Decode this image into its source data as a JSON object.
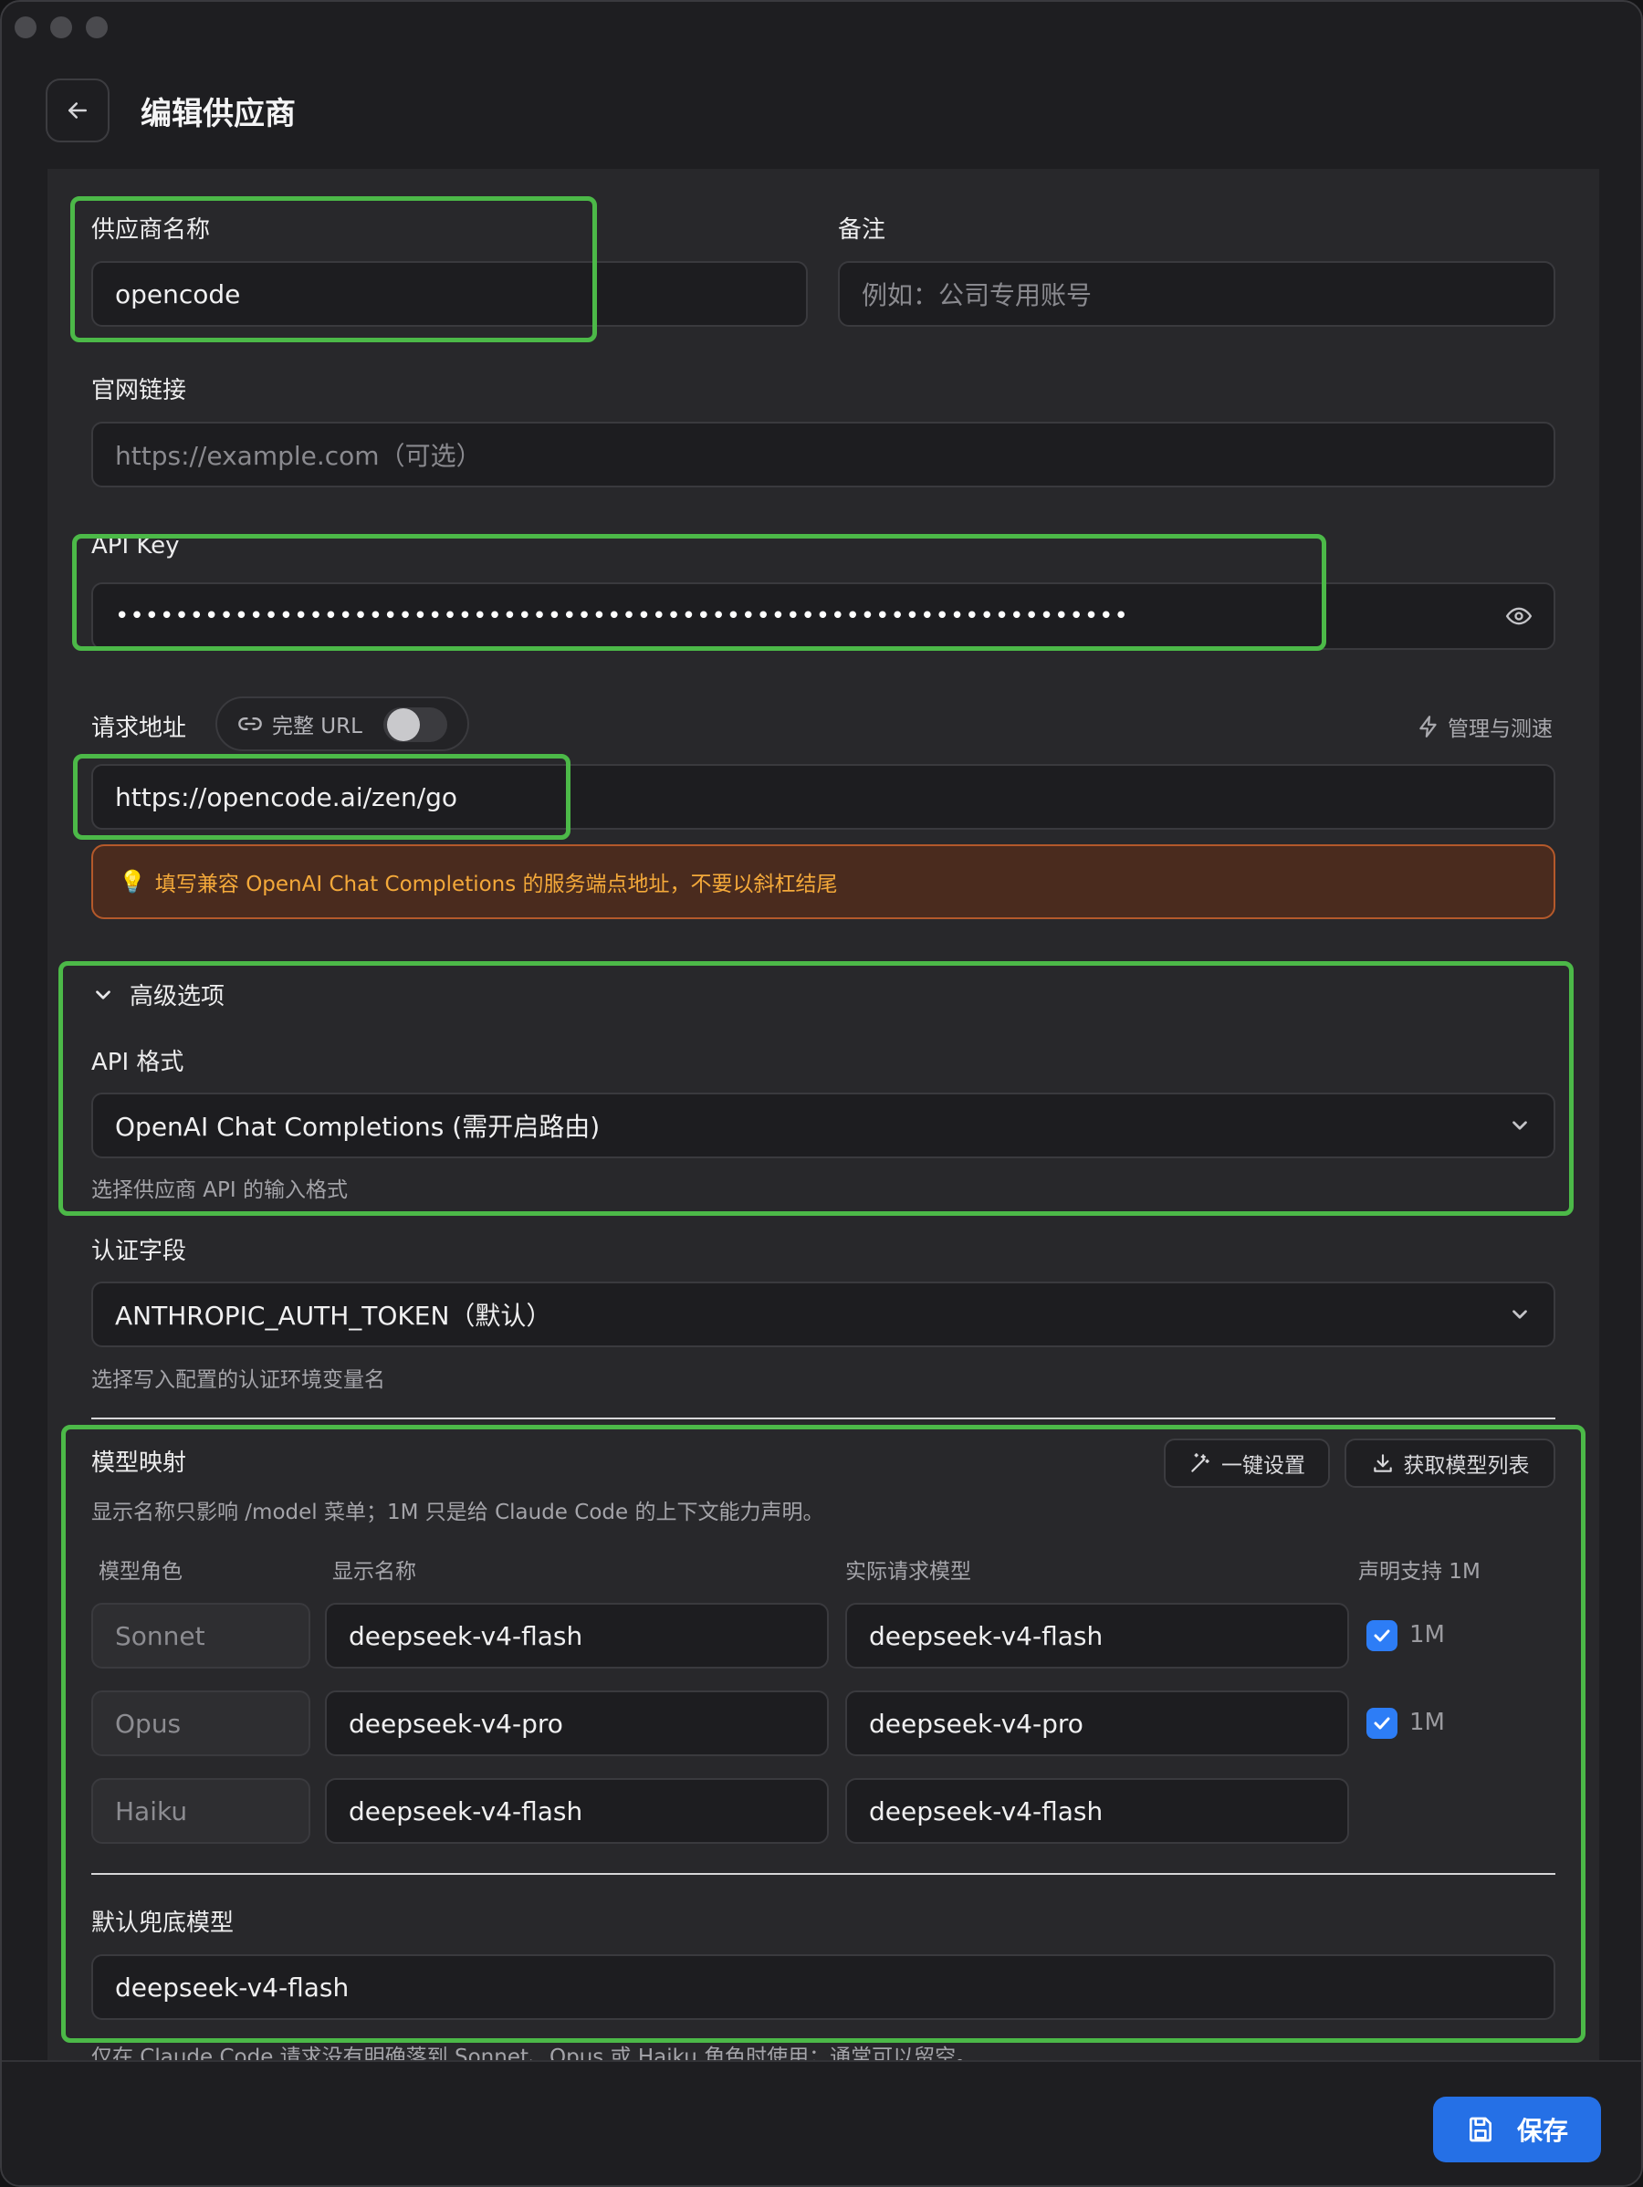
{
  "header": {
    "title": "编辑供应商"
  },
  "form": {
    "provider_name": {
      "label": "供应商名称",
      "value": "opencode"
    },
    "notes": {
      "label": "备注",
      "placeholder": "例如：公司专用账号"
    },
    "website": {
      "label": "官网链接",
      "placeholder": "https://example.com（可选）"
    },
    "api_key": {
      "label": "API Key",
      "value": "••••••••••••••••••••••••••••••••••••••••••••••••••••••••••••••••••••"
    },
    "endpoint": {
      "label": "请求地址",
      "full_url_toggle": "完整 URL",
      "full_url_on": false,
      "manage_link": "管理与测速",
      "value": "https://opencode.ai/zen/go",
      "tip_icon": "lightbulb-icon",
      "tip": "填写兼容 OpenAI Chat Completions 的服务端点地址，不要以斜杠结尾"
    }
  },
  "advanced": {
    "title": "高级选项",
    "api_format": {
      "label": "API 格式",
      "value": "OpenAI Chat Completions (需开启路由)",
      "hint": "选择供应商 API 的输入格式"
    },
    "auth_field": {
      "label": "认证字段",
      "value": "ANTHROPIC_AUTH_TOKEN（默认）",
      "hint": "选择写入配置的认证环境变量名"
    }
  },
  "model_mapping": {
    "title": "模型映射",
    "description": "显示名称只影响 /model 菜单；1M 只是给 Claude Code 的上下文能力声明。",
    "one_click_button": "一键设置",
    "fetch_models_button": "获取模型列表",
    "columns": [
      "模型角色",
      "显示名称",
      "实际请求模型",
      "声明支持 1M"
    ],
    "rows": [
      {
        "role": "Sonnet",
        "display": "deepseek-v4-flash",
        "actual": "deepseek-v4-flash",
        "supports_1m": true,
        "one_m_label": "1M"
      },
      {
        "role": "Opus",
        "display": "deepseek-v4-pro",
        "actual": "deepseek-v4-pro",
        "supports_1m": true,
        "one_m_label": "1M"
      },
      {
        "role": "Haiku",
        "display": "deepseek-v4-flash",
        "actual": "deepseek-v4-flash",
        "supports_1m": false,
        "one_m_label": ""
      }
    ],
    "fallback": {
      "label": "默认兜底模型",
      "value": "deepseek-v4-flash",
      "hint": "仅在 Claude Code 请求没有明确落到 Sonnet、Opus 或 Haiku 角色时使用；通常可以留空。"
    }
  },
  "footer": {
    "save_label": "保存"
  },
  "colors": {
    "accent": "#2570e6",
    "highlight": "#4cb948",
    "tip_text": "#f4a93a",
    "checkbox": "#2d7df6"
  }
}
